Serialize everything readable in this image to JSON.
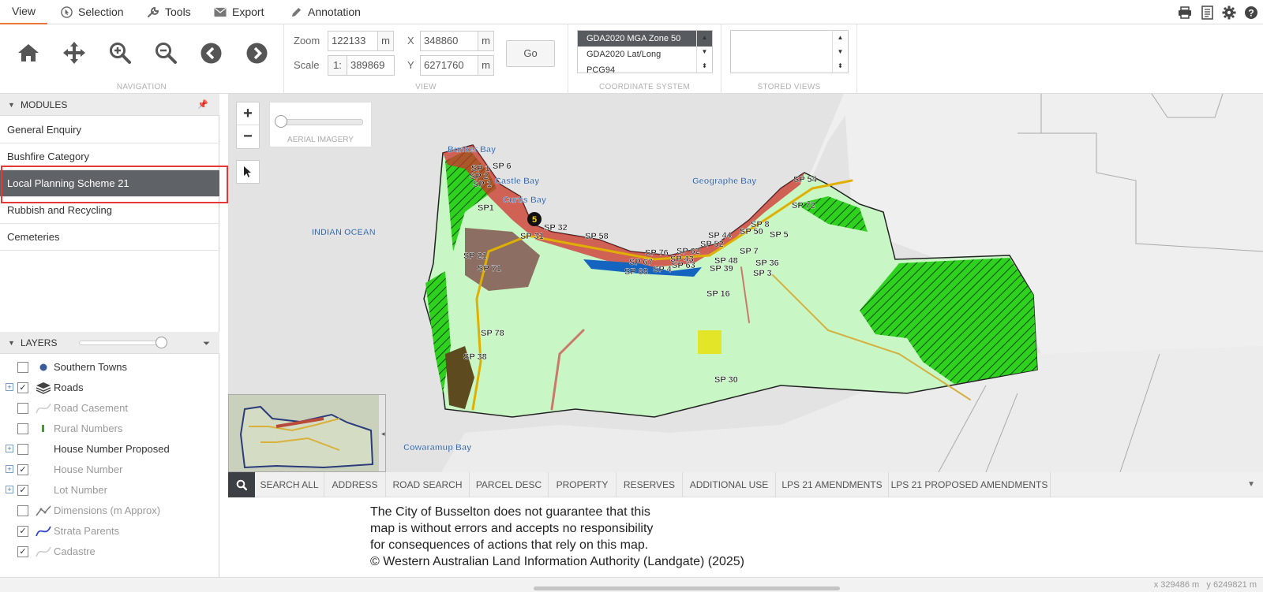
{
  "menu": {
    "view": "View",
    "selection": "Selection",
    "tools": "Tools",
    "export": "Export",
    "annotation": "Annotation"
  },
  "ribbon": {
    "navigation_caption": "NAVIGATION",
    "view_caption": "VIEW",
    "coord_caption": "COORDINATE SYSTEM",
    "stored_caption": "STORED VIEWS",
    "zoom_label": "Zoom",
    "zoom_value": "122133",
    "zoom_unit": "m",
    "scale_label": "Scale",
    "scale_prefix": "1:",
    "scale_value": "389869",
    "x_label": "X",
    "x_value": "348860",
    "x_unit": "m",
    "y_label": "Y",
    "y_value": "6271760",
    "y_unit": "m",
    "go_label": "Go",
    "coord_systems": [
      "GDA2020 MGA Zone 50",
      "GDA2020 Lat/Long",
      "PCG94"
    ]
  },
  "modules": {
    "header": "MODULES",
    "items": [
      "General Enquiry",
      "Bushfire Category",
      "Local Planning Scheme 21",
      "Rubbish and Recycling",
      "Cemeteries"
    ],
    "active_index": 2
  },
  "layers": {
    "header": "LAYERS",
    "items": [
      {
        "label": "Southern Towns",
        "checked": false,
        "expandable": false,
        "dim": false
      },
      {
        "label": "Roads",
        "checked": true,
        "expandable": true,
        "dim": false
      },
      {
        "label": "Road Casement",
        "checked": false,
        "expandable": false,
        "dim": true
      },
      {
        "label": "Rural Numbers",
        "checked": false,
        "expandable": false,
        "dim": true
      },
      {
        "label": "House Number Proposed",
        "checked": false,
        "expandable": true,
        "dim": false
      },
      {
        "label": "House Number",
        "checked": true,
        "expandable": true,
        "dim": true
      },
      {
        "label": "Lot Number",
        "checked": true,
        "expandable": true,
        "dim": true
      },
      {
        "label": "Dimensions (m Approx)",
        "checked": false,
        "expandable": false,
        "dim": true
      },
      {
        "label": "Strata Parents",
        "checked": true,
        "expandable": false,
        "dim": true
      },
      {
        "label": "Cadastre",
        "checked": true,
        "expandable": false,
        "dim": true
      }
    ]
  },
  "map": {
    "imagery_label": "AERIAL IMAGERY",
    "place_labels": [
      "Bunker Bay",
      "Castle Bay",
      "Curtis Bay",
      "Geographe Bay",
      "INDIAN OCEAN",
      "Cowaramup Bay"
    ],
    "sp_labels": [
      "SP 1",
      "SP 2",
      "SP 6",
      "SP 1",
      "SP1",
      "SP 31",
      "SP 32",
      "SP 58",
      "SP 21",
      "SP 71",
      "SP 78",
      "SP 38",
      "SP 76",
      "SP 67",
      "SP 68",
      "SP 4",
      "SP 62",
      "SP 43",
      "SP 63",
      "SP 44",
      "SP 52",
      "SP 48",
      "SP 39",
      "SP 50",
      "SP 8",
      "SP 5",
      "SP 7",
      "SP 36",
      "SP 3",
      "SP 16",
      "SP 72",
      "SP 54",
      "SP 30"
    ],
    "marker_number": "5"
  },
  "search": {
    "tabs": [
      "SEARCH ALL",
      "ADDRESS",
      "ROAD SEARCH",
      "PARCEL DESC",
      "PROPERTY",
      "RESERVES",
      "ADDITIONAL USE",
      "LPS 21 AMENDMENTS",
      "LPS 21 PROPOSED AMENDMENTS"
    ]
  },
  "disclaimer": {
    "line1": "The City of Busselton does not guarantee that this",
    "line2": "map is without errors and accepts no responsibility",
    "line3": "for consequences of actions that rely on this map.",
    "line4": "© Western Australian Land Information Authority (Landgate) (2025)"
  },
  "status": {
    "x_coord": "x  329486 m",
    "y_coord": "y  6249821 m"
  },
  "colors": {
    "accent": "#e8763a",
    "active_module": "#5f6266",
    "highlight": "#e53935",
    "map_land": "#ccf5c9",
    "map_hatch": "#33dd22",
    "sea": "#e3e3e3"
  }
}
